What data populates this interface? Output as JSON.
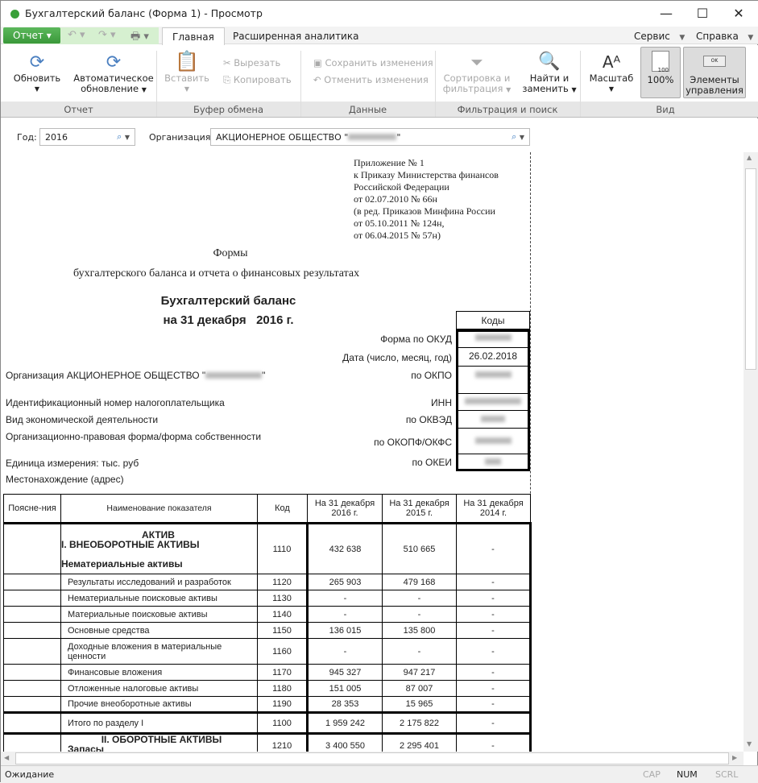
{
  "window": {
    "title": "Бухгалтерский баланс (Форма 1) - Просмотр",
    "minimize": "—",
    "maximize": "☐",
    "close": "✕"
  },
  "menu": {
    "report": "Отчет",
    "tabs": [
      "Главная",
      "Расширенная аналитика"
    ],
    "service": "Сервис",
    "help": "Справка"
  },
  "ribbon": {
    "refresh": "Обновить",
    "auto_refresh_1": "Автоматическое",
    "auto_refresh_2": "обновление",
    "paste": "Вставить",
    "cut": "Вырезать",
    "copy": "Копировать",
    "save": "Сохранить изменения",
    "undo": "Отменить изменения",
    "sort_1": "Сортировка и",
    "sort_2": "фильтрация",
    "find_1": "Найти и",
    "find_2": "заменить",
    "zoom": "Масштаб",
    "zoom100": "100%",
    "controls_1": "Элементы",
    "controls_2": "управления",
    "groups": [
      "Отчет",
      "Буфер обмена",
      "Данные",
      "Фильтрация и поиск",
      "Вид"
    ]
  },
  "filters": {
    "year_label": "Год:",
    "year_value": "2016",
    "org_label": "Организация:",
    "org_value": "АКЦИОНЕРНОЕ ОБЩЕСТВО \""
  },
  "doc": {
    "appendix": [
      "Приложение № 1",
      "к Приказу Министерства финансов",
      "Российской Федерации",
      "от 02.07.2010 № 66н",
      "(в ред. Приказов Минфина России",
      "от 05.10.2011 № 124н,",
      "от 06.04.2015 № 57н)"
    ],
    "forms": "Формы",
    "forms_sub": "бухгалтерского баланса и отчета о финансовых результатах",
    "title": "Бухгалтерский баланс",
    "date": "на 31 декабря   2016 г.",
    "codes_header": "Коды",
    "okud": "Форма по ОКУД",
    "date_label": "Дата (число, месяц, год)",
    "date_value": "26.02.2018",
    "org": "Организация АКЦИОНЕРНОЕ ОБЩЕСТВО \"",
    "okpo": "по ОКПО",
    "inn_label": "Идентификационный номер налогоплательщика",
    "inn": "ИНН",
    "activity": "Вид экономической деятельности",
    "okved": "по ОКВЭД",
    "legal_form": "Организационно-правовая форма/форма собственности",
    "okopf": "по ОКОПФ/ОКФС",
    "unit": "Единица измерения: тыс. руб",
    "okei": "по ОКЕИ",
    "address": "Местонахождение (адрес)"
  },
  "table": {
    "headers": [
      "Поясне-ния",
      "Наименование показателя",
      "Код",
      "На 31 декабря 2016 г.",
      "На 31 декабря 2015 г.",
      "На 31 декабря 2014 г."
    ],
    "rows": [
      {
        "name": "",
        "code": "1110",
        "v1": "432 638",
        "v2": "510 665",
        "v3": "-"
      },
      {
        "name": "Результаты исследований и разработок",
        "code": "1120",
        "v1": "265 903",
        "v2": "479 168",
        "v3": "-"
      },
      {
        "name": "Нематериальные поисковые активы",
        "code": "1130",
        "v1": "-",
        "v2": "-",
        "v3": "-"
      },
      {
        "name": "Материальные поисковые активы",
        "code": "1140",
        "v1": "-",
        "v2": "-",
        "v3": "-"
      },
      {
        "name": "Основные средства",
        "code": "1150",
        "v1": "136 015",
        "v2": "135 800",
        "v3": "-"
      },
      {
        "name": "Доходные вложения в материальные ценности",
        "code": "1160",
        "v1": "-",
        "v2": "-",
        "v3": "-"
      },
      {
        "name": "Финансовые вложения",
        "code": "1170",
        "v1": "945 327",
        "v2": "947 217",
        "v3": "-"
      },
      {
        "name": "Отложенные налоговые активы",
        "code": "1180",
        "v1": "151 005",
        "v2": "87 007",
        "v3": "-"
      },
      {
        "name": "Прочие внеоборотные активы",
        "code": "1190",
        "v1": "28 353",
        "v2": "15 965",
        "v3": "-"
      },
      {
        "name": "Итого по разделу I",
        "code": "1100",
        "v1": "1 959 242",
        "v2": "2 175 822",
        "v3": "-"
      },
      {
        "name": "",
        "code": "1210",
        "v1": "3 400 550",
        "v2": "2 295 401",
        "v3": "-"
      }
    ],
    "section1": [
      "АКТИВ",
      "I. ВНЕОБОРОТНЫЕ АКТИВЫ",
      "Нематериальные активы"
    ],
    "section2": [
      "II. ОБОРОТНЫЕ АКТИВЫ",
      "Запасы"
    ]
  },
  "status": {
    "text": "Ожидание",
    "cap": "CAP",
    "num": "NUM",
    "scrl": "SCRL"
  }
}
